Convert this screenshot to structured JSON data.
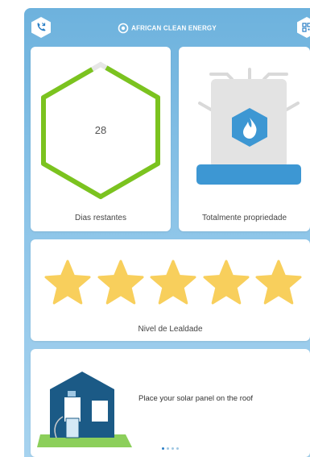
{
  "header": {
    "brand": "AFRICAN CLEAN ENERGY",
    "call_icon": "phone-icon",
    "scan_icon": "qr-code-icon"
  },
  "days_card": {
    "value": "28",
    "label": "Dias restantes"
  },
  "ownership_card": {
    "label": "Totalmente propriedade",
    "icon": "cookstove-flame-icon"
  },
  "loyalty_card": {
    "label": "Nivel de Lealdade",
    "stars_filled": 5,
    "stars_total": 5
  },
  "tips_card": {
    "text": "Place your solar panel on the roof",
    "pages_total": 4,
    "current_page": 1
  },
  "colors": {
    "background": "#8cc4e8",
    "ring": "#7bc31f",
    "star": "#f8cf5c",
    "house": "#1b5a86",
    "stove_base": "#3d97d3"
  }
}
